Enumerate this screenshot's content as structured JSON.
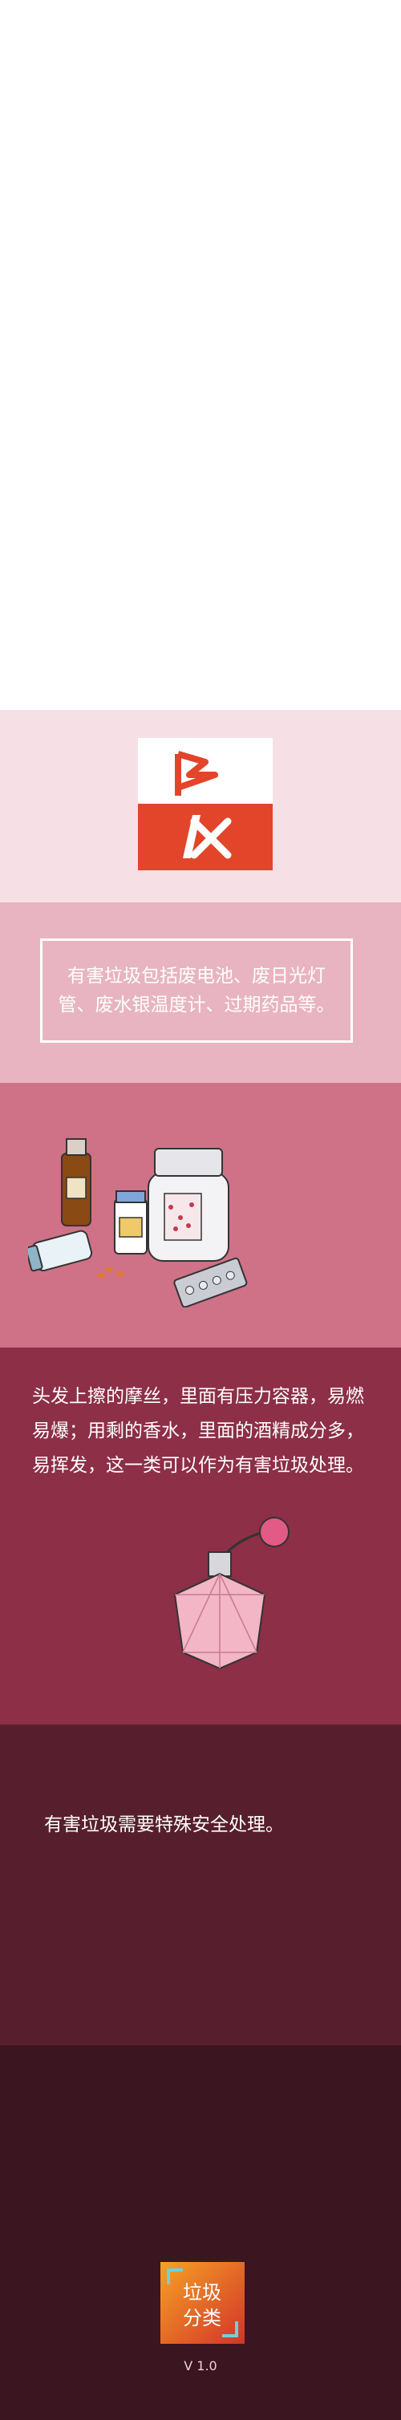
{
  "sections": {
    "intro": {
      "text": "有害垃圾包括废电池、废日光灯管、废水银温度计、过期药品等。"
    },
    "description": {
      "text": "头发上擦的摩丝，里面有压力容器，易燃易爆；用剩的香水，里面的酒精成分多，易挥发，这一类可以作为有害垃圾处理。"
    },
    "notice": {
      "text": "有害垃圾需要特殊安全处理。"
    },
    "footer": {
      "logo_line1": "垃圾",
      "logo_line2": "分类",
      "version": "V 1.0"
    }
  },
  "colors": {
    "hazard_red": "#e2452a",
    "bg_blank": "#ffffff",
    "bg_light_pink": "#f6e0e6",
    "bg_pink": "#e8b4c1",
    "bg_rose": "#cf7187",
    "bg_wine": "#8c2f47",
    "bg_maroon": "#571f2d",
    "bg_dark": "#3b1520"
  },
  "icons": [
    "hazardous-waste-icon",
    "medicine-bottles-icon",
    "perfume-bottle-icon",
    "app-logo-icon"
  ]
}
